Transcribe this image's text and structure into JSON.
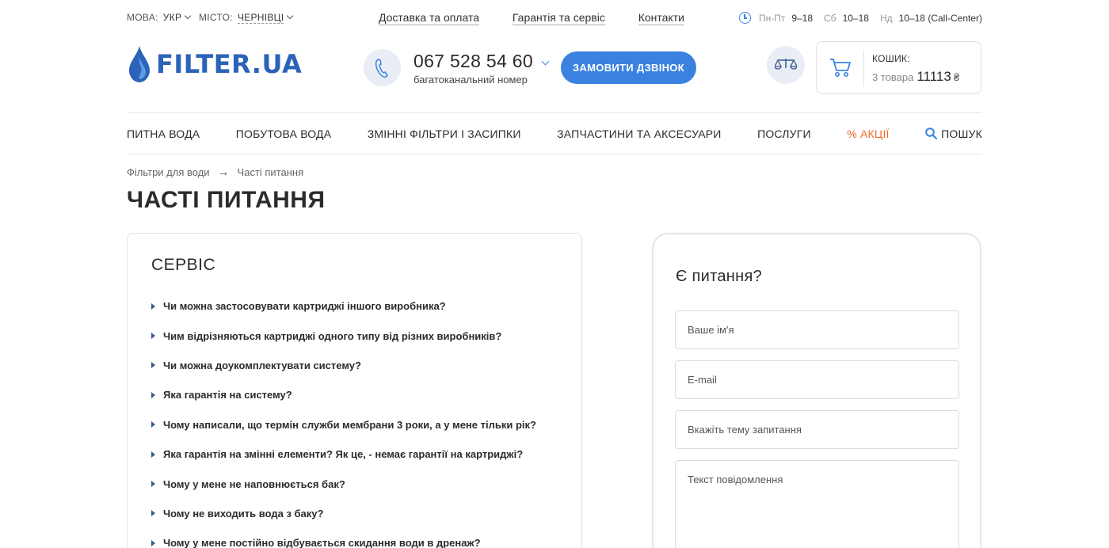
{
  "topbar": {
    "lang_label": "МОВА:",
    "lang_value": "УКР",
    "city_label": "МІСТО:",
    "city_value": "ЧЕРНІВЦІ",
    "links": [
      "Доставка та оплата",
      "Гарантія та сервіс",
      "Контакти"
    ],
    "hours": [
      {
        "day": "Пн-Пт",
        "time": "9–18"
      },
      {
        "day": "Сб",
        "time": "10–18"
      },
      {
        "day": "Нд",
        "time": "10–18 (Call-Center)"
      }
    ],
    "accent_color": "#3b82e0"
  },
  "header": {
    "logo_text": "FILTER.UA",
    "phone": "067 528 54 60",
    "phone_sub": "багатоканальний номер",
    "callback_label": "ЗАМОВИТИ ДЗВІНОК",
    "cart_label": "КОШИК:",
    "cart_count": "3 товара",
    "cart_sum": "11113",
    "cart_currency": "₴"
  },
  "nav": {
    "items": [
      "ПИТНА ВОДА",
      "ПОБУТОВА ВОДА",
      "ЗМІННІ ФІЛЬТРИ І ЗАСИПКИ",
      "ЗАПЧАСТИНИ ТА АКСЕСУАРИ",
      "ПОСЛУГИ"
    ],
    "promo": "% АКЦІЇ",
    "search": "ПОШУК",
    "promo_color": "#ef6c2a"
  },
  "breadcrumb": {
    "parent": "Фільтри для води",
    "current": "Часті питання"
  },
  "page_title": "ЧАСТІ ПИТАННЯ",
  "faq": {
    "title": "СЕРВІС",
    "items": [
      "Чи можна застосовувати картриджі іншого виробника?",
      "Чим відрізняються картриджі одного типу від різних виробників?",
      "Чи можна доукомплектувати систему?",
      "Яка гарантія на систему?",
      "Чому написали, що термін служби мембрани 3 роки, а у мене тільки рік?",
      "Яка гарантія на змінні елементи? Як це, - немає гарантії на картриджі?",
      "Чому у мене не наповнюється бак?",
      "Чому не виходить вода з баку?",
      "Чому у мене постійно відбувається скидання води в дренаж?"
    ]
  },
  "form": {
    "title": "Є питання?",
    "name_placeholder": "Ваше ім'я",
    "email_placeholder": "E-mail",
    "subject_placeholder": "Вкажіть тему запитання",
    "message_placeholder": "Текст повідомлення"
  }
}
